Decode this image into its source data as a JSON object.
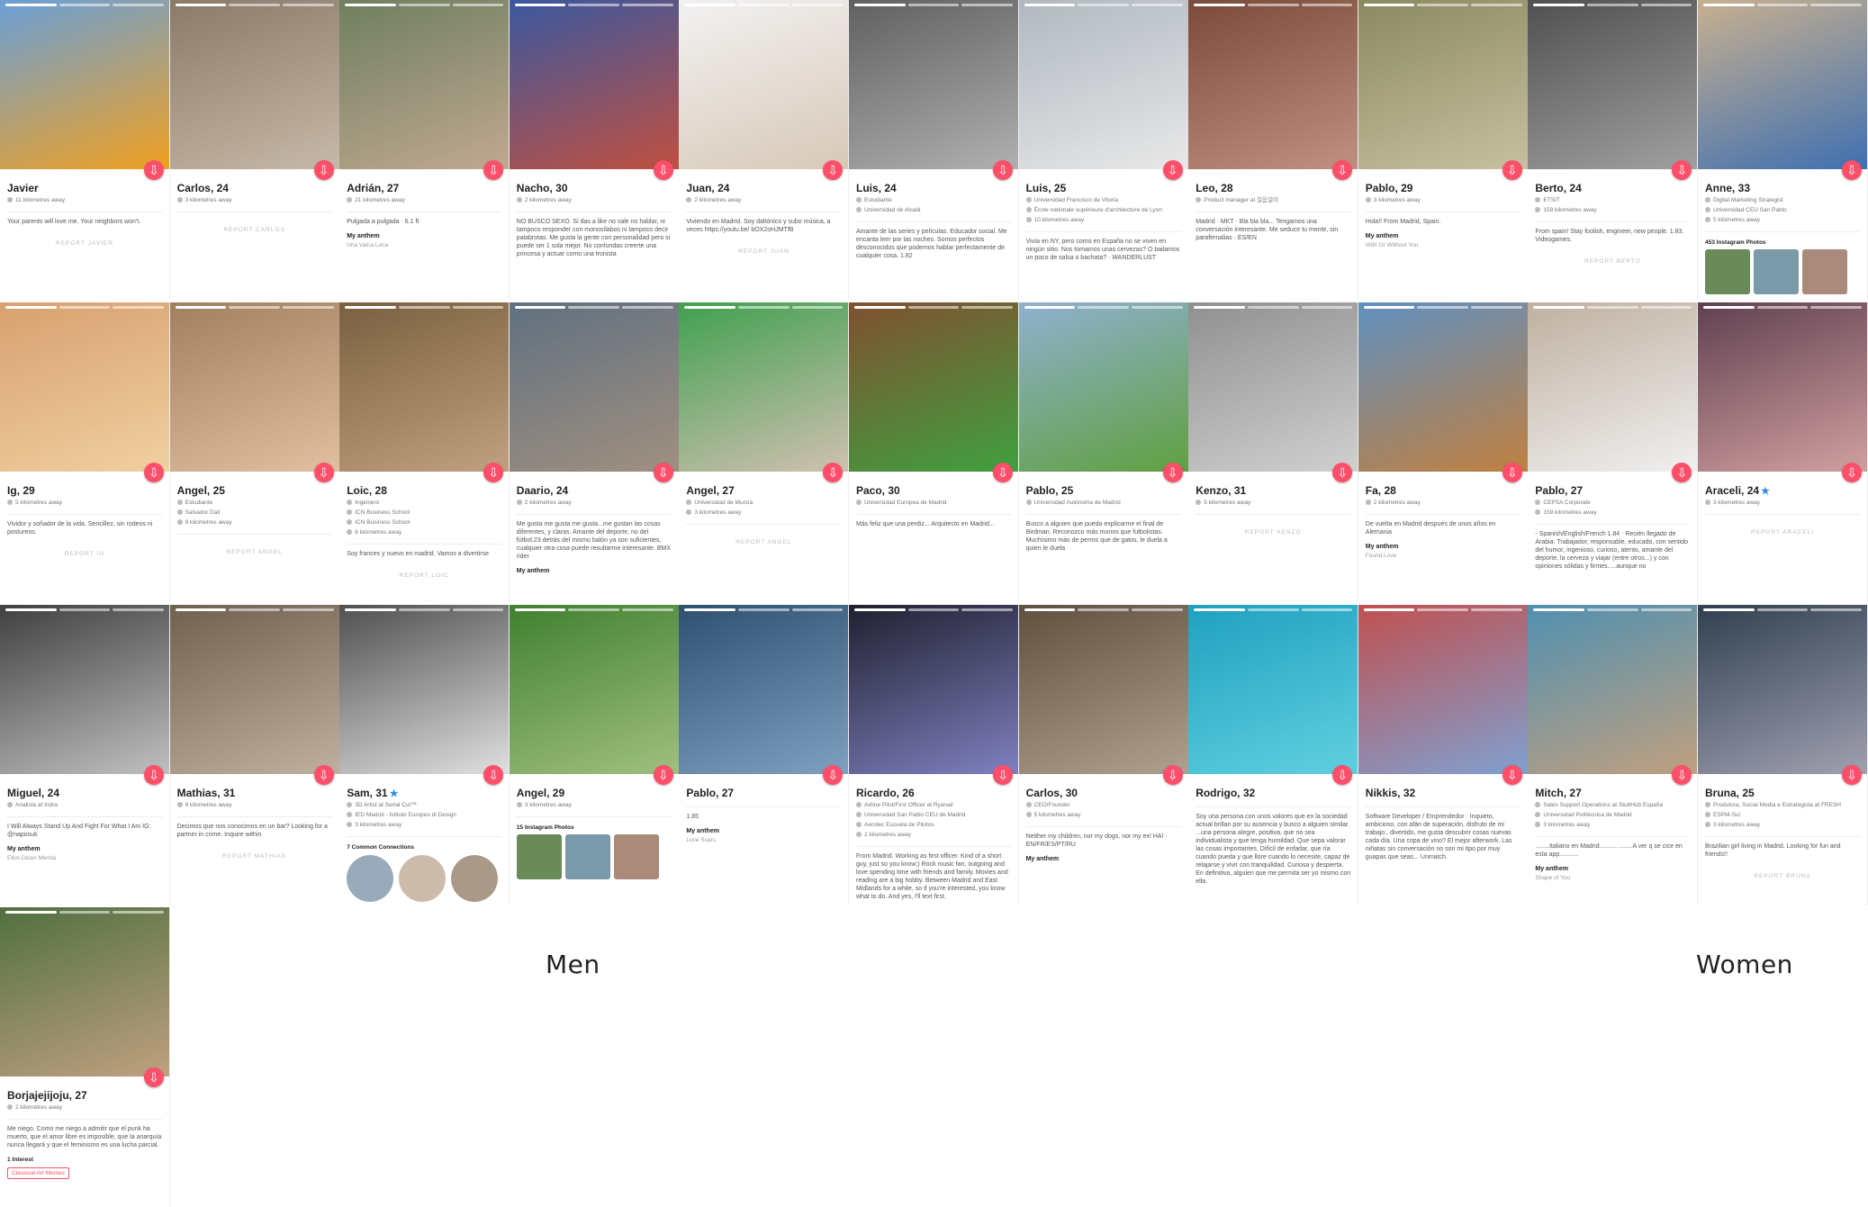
{
  "labels": {
    "men": "Men",
    "women": "Women"
  },
  "profiles": [
    {
      "name": "Javier",
      "meta": [
        "11 kilometres away"
      ],
      "bio": "Your parents will love me. Your neighbors won't.",
      "report": "REPORT JAVIER",
      "photo": [
        "#6aa0d8",
        "#f0a020"
      ]
    },
    {
      "name": "Carlos, 24",
      "meta": [
        "3 kilometres away"
      ],
      "bio": "",
      "report": "REPORT CARLOS",
      "photo": [
        "#8a7a6a",
        "#c7b8a8"
      ]
    },
    {
      "name": "Adrián, 27",
      "meta": [
        "21 kilometres away"
      ],
      "bio": "Pulgada a pulgada · 6.1 ft",
      "anthem": "My anthem",
      "song": "Una Vaina Loca",
      "photo": [
        "#6f7f60",
        "#c0a890"
      ]
    },
    {
      "name": "Nacho, 30",
      "meta": [
        "2 kilometres away"
      ],
      "bio": "NO BUSCO SEXO. Si das a like no vale no hablar, ni tampoco responder con monosílabos ni tampoco decir palabrotas. Me gusta la gente con personalidad pero si puede ser 1 sola mejor. No confundas creerte una princesa y actuar como una tronista",
      "photo": [
        "#3a58a0",
        "#c05040"
      ]
    },
    {
      "name": "Juan, 24",
      "meta": [
        "2 kilometres away"
      ],
      "bio": "Viviendo en Madrid. Soy daltónico y subo música, a veces https://youtu.be/ bOX2oHJMTfB",
      "report": "REPORT JUAN",
      "photo": [
        "#f2f2f2",
        "#d8c8b8"
      ]
    },
    {
      "name": "Luis, 24",
      "meta": [
        "Estudiante",
        "Universidad de Alcalá"
      ],
      "bio": "Amante de las series y películas. Educador social. Me encanta leer por las noches. Somos perfectos desconocidos que podemos hablar perfectamente de cualquier cosa. 1.82",
      "photo": [
        "#606060",
        "#b0b0b0"
      ]
    },
    {
      "name": "Luis, 25",
      "meta": [
        "Universidad Francisco de Vitoria",
        "École nationale supérieure d'architecture de Lyon",
        "10 kilometres away"
      ],
      "bio": "Vivía en NY, pero como en España no se viven en ningún sitio. Nos tomamos unas cervezas? O bailamos un poco de salsa o bachata? · WANDERLUST",
      "photo": [
        "#b0b8c0",
        "#e8e8e8"
      ]
    },
    {
      "name": "Leo, 28",
      "meta": [
        "Product manager at 걸음걸이"
      ],
      "bio": "Madrid · MKT · Bla bla bla... Tengamos una conversación interesante. Me seduce tu mente, sin parafernalias · ES/EN",
      "photo": [
        "#7a4a3a",
        "#c09080"
      ]
    },
    {
      "name": "Pablo, 29",
      "meta": [
        "3 kilometres away"
      ],
      "bio": "Hola!! From Madrid, Spain.",
      "anthem": "My anthem",
      "song": "With Or Without You",
      "photo": [
        "#8a8a60",
        "#c8c0a0"
      ]
    },
    {
      "name": "Berto, 24",
      "meta": [
        "ETSIT",
        "159 kilometres away"
      ],
      "bio": "From spain! Stay foolish, engineer, new people. 1.83. Videogames.",
      "report": "REPORT BERTO",
      "photo": [
        "#505050",
        "#a0a0a0"
      ]
    },
    {
      "name": "Anne, 33",
      "meta": [
        "Digital Marketing Strategist",
        "Universidad CEU San Pablo",
        "5 kilometres away"
      ],
      "bio": "",
      "extra": "453 Instagram Photos",
      "photo": [
        "#c8b090",
        "#4070b0"
      ]
    },
    {
      "name": "Ig, 29",
      "meta": [
        "5 kilometres away"
      ],
      "bio": "Vividor y soñador de la vida. Sencillez, sin rodeos ni postureos.",
      "report": "REPORT IG",
      "photo": [
        "#d8a070",
        "#f0d0a0"
      ]
    },
    {
      "name": "Angel, 25",
      "meta": [
        "Estudiante",
        "Salvador Dalí",
        "8 kilometres away"
      ],
      "bio": "",
      "report": "REPORT ANGEL",
      "photo": [
        "#a08060",
        "#e0c0a0"
      ]
    },
    {
      "name": "Loic, 28",
      "meta": [
        "Ingeniero",
        "ICN Business School",
        "ICN Business School",
        "6 kilometres away"
      ],
      "bio": "Soy frances y nuevo en madrid. Vamos a divertirse",
      "report": "REPORT LOIC",
      "photo": [
        "#7a6040",
        "#c0a080"
      ]
    },
    {
      "name": "Daario, 24",
      "meta": [
        "2 kilometres away"
      ],
      "bio": "Me gusta me gusta me gusta...me gustan las cosas diferentes, y claras. Amante del deporte, no del fútbol,23 detrás del mismo balón ya son suficientes, cualquier otra cosa puede resultarme interesante. BMX rider",
      "anthem": "My anthem",
      "photo": [
        "#607080",
        "#a09080"
      ]
    },
    {
      "name": "Angel, 27",
      "meta": [
        "Universidad de Murcia",
        "3 kilometres away"
      ],
      "bio": "",
      "report": "REPORT ANGEL",
      "photo": [
        "#40a050",
        "#d0c0b0"
      ]
    },
    {
      "name": "Paco, 30",
      "meta": [
        "Universidad Europea de Madrid"
      ],
      "bio": "Más feliz que una perdiz... Arquitecto en Madrid...",
      "photo": [
        "#805030",
        "#40a040"
      ]
    },
    {
      "name": "Pablo, 25",
      "meta": [
        "Universidad Autónoma de Madrid"
      ],
      "bio": "Busco a alguien que pueda explicarme el final de Birdman. Reconozco más monos que futbolistas. Muchísimo más de perros que de gatos, le duela a quien le duela",
      "photo": [
        "#90b0d0",
        "#60a040"
      ]
    },
    {
      "name": "Kenzo, 31",
      "meta": [
        "5 kilometres away"
      ],
      "bio": "",
      "report": "REPORT KENZO",
      "photo": [
        "#909090",
        "#d0d0d0"
      ]
    },
    {
      "name": "Fa, 28",
      "meta": [
        "2 kilometres away"
      ],
      "bio": "De vuelta en Madrid después de unos años en Alemania",
      "anthem": "My anthem",
      "song": "Found Love",
      "photo": [
        "#6090c0",
        "#c08040"
      ]
    },
    {
      "name": "Pablo, 27",
      "meta": [
        "CEPSA Corporate",
        "159 kilometres away"
      ],
      "bio": "- Spanish/English/French 1.84 · Recién llegado de Arabia. Trabajador, responsable, educado, con sentido del humor, ingenioso, curioso, atento, amante del deporte, la cerveza y viajar (entre otros...) y con opiniones sólidas y firmes.....aunque no",
      "photo": [
        "#c0b0a0",
        "#f0f0f0"
      ]
    },
    {
      "name": "Araceli, 24",
      "verified": true,
      "meta": [
        "3 kilometres away"
      ],
      "bio": "",
      "report": "REPORT ARACELI",
      "photo": [
        "#604050",
        "#d0a0a0"
      ]
    },
    {
      "name": "Miguel, 24",
      "meta": [
        "Analista at Indra"
      ],
      "bio": "I Will Always Stand Up And Fight For What I Am IG: @naposuk",
      "anthem": "My anthem",
      "song": "Ellos Dicen Mierda",
      "photo": [
        "#404040",
        "#c0c0c0"
      ]
    },
    {
      "name": "Mathias, 31",
      "meta": [
        "8 kilometres away"
      ],
      "bio": "Decimos que nos conocimos en un bar? Looking for a partner in crime. Inquire within",
      "report": "REPORT MATHIAS",
      "photo": [
        "#706050",
        "#c0b0a0"
      ]
    },
    {
      "name": "Sam, 31",
      "verified": true,
      "meta": [
        "3D Artist at Serial Cut™",
        "IED Madrid - Istituto Europeo di Design",
        "3 kilometres away"
      ],
      "bio": "",
      "extra": "7 Common Connections",
      "photo": [
        "#505050",
        "#e0e0e0"
      ]
    },
    {
      "name": "Angel, 29",
      "meta": [
        "3 kilometres away"
      ],
      "bio": "",
      "extra": "15 Instagram Photos",
      "photo": [
        "#408030",
        "#a0c080"
      ]
    },
    {
      "name": "Pablo, 27",
      "meta": [],
      "bio": "1.85",
      "anthem": "My anthem",
      "song": "Love Scars",
      "photo": [
        "#305070",
        "#80a0c0"
      ]
    },
    {
      "name": "Ricardo, 26",
      "meta": [
        "Airline Pilot/First Officer at Ryanair",
        "Universidad San Pablo CEU de Madrid",
        "Aerotec Escuela de Pilotos",
        "2 kilometres away"
      ],
      "bio": "From Madrid. Working as first officer. Kind of a short guy, just so you know;) Rock music fan, outgoing and love spending time with friends and family. Movies and reading are a big hobby. Between Madrid and East Midlands for a while, so if you're interested, you know what to do. And yes, I'll text first.",
      "photo": [
        "#202030",
        "#8080c0"
      ]
    },
    {
      "name": "Carlos, 30",
      "meta": [
        "CEO/Founder",
        "5 kilometres away"
      ],
      "bio": "Neither my children, nor my dogs, nor my ex! HA! · EN/FR/ES/PT/RU",
      "anthem": "My anthem",
      "photo": [
        "#605040",
        "#b0a090"
      ]
    },
    {
      "name": "Rodrigo, 32",
      "meta": [],
      "bio": "Soy una persona con unos valores que en la sociedad actual brillan por su ausencia y busco a alguien similar. ...una persona alegre, positiva, que no sea individualista y que tenga humildad. Que sepa valorar las cosas importantes. Difícil de enfadar, que ría cuando pueda y que llore cuando lo necesite, capaz de relajarse y vivir con tranquilidad. Curiosa y despierta. En definitiva, alguien que me permita ser yo mismo con ella.",
      "photo": [
        "#20a0c0",
        "#60d0e0"
      ]
    },
    {
      "name": "Nikkis, 32",
      "meta": [],
      "bio": "Software Developer / Emprendedor · Inquieto, ambicioso, con afán de superación, disfruto de mi trabajo.. divertido, me gusta descubrir cosas nuevas cada día. Una copa de vino? El mejor afterwork. Las niñatas sin conversación no son mi tipo por muy guapas que seas... Unmatch.",
      "photo": [
        "#c05050",
        "#80a0d0"
      ]
    },
    {
      "name": "Mitch, 27",
      "meta": [
        "Sales Support Operations at StubHub España",
        "Universidad Politécnica de Madrid",
        "3 kilometres away"
      ],
      "bio": "........Italiano en Madrid.......... ........A ver q se cice en esta app...........",
      "anthem": "My anthem",
      "song": "Shape of You",
      "photo": [
        "#5090b0",
        "#c0a080"
      ]
    },
    {
      "name": "Bruna, 25",
      "meta": [
        "Produtora, Social Media e Estrategista at FRESH",
        "ESPM-Sul",
        "3 kilometres away"
      ],
      "bio": "Brazilian girl living in Madrid. Looking for fun and friends!!",
      "report": "REPORT BRUNA",
      "photo": [
        "#304050",
        "#a0a0b0"
      ]
    },
    {
      "name": "Borjajejijoju, 27",
      "meta": [
        "2 kilometres away"
      ],
      "bio": "Me niego. Como me niego a admitir que el punk ha muerto, que el amor libre es imposible, que la anarquía nunca llegará y que el feminismo es una lucha parcial.",
      "extra": "1 Interest",
      "tag": "Classical Art Memes",
      "photo": [
        "#507040",
        "#c0a080"
      ]
    }
  ]
}
